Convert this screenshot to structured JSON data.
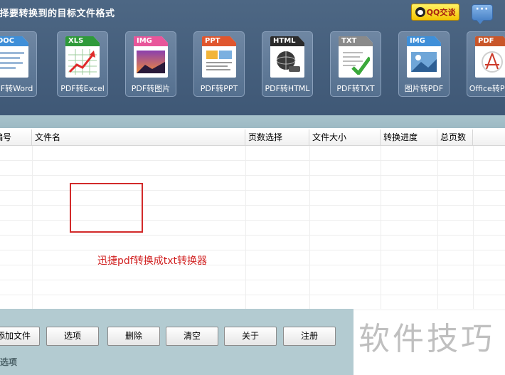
{
  "header": {
    "title": "选择要转换到的目标文件格式",
    "qq_label": "QQ交谈",
    "tiles": [
      {
        "badge": "DOC",
        "badge_color": "#3f8fd8",
        "label": "PDF转Word"
      },
      {
        "badge": "XLS",
        "badge_color": "#2f9a3a",
        "label": "PDF转Excel"
      },
      {
        "badge": "IMG",
        "badge_color": "#e8569a",
        "label": "PDF转图片"
      },
      {
        "badge": "PPT",
        "badge_color": "#e0562e",
        "label": "PDF转PPT"
      },
      {
        "badge": "HTML",
        "badge_color": "#2b2b2b",
        "label": "PDF转HTML"
      },
      {
        "badge": "TXT",
        "badge_color": "#8a8a8a",
        "label": "PDF转TXT"
      },
      {
        "badge": "IMG",
        "badge_color": "#3f8fd8",
        "label": "图片转PDF"
      },
      {
        "badge": "PDF",
        "badge_color": "#c9562a",
        "label": "Office转PDF"
      }
    ]
  },
  "table": {
    "columns": [
      "编号",
      "文件名",
      "页数选择",
      "文件大小",
      "转换进度",
      "总页数"
    ]
  },
  "annotation": "迅捷pdf转换成txt转换器",
  "toolbar": {
    "buttons": [
      "添加文件",
      "选项",
      "删除",
      "清空",
      "关于",
      "注册"
    ]
  },
  "options_heading": "输出选项",
  "watermark": "软件技巧"
}
